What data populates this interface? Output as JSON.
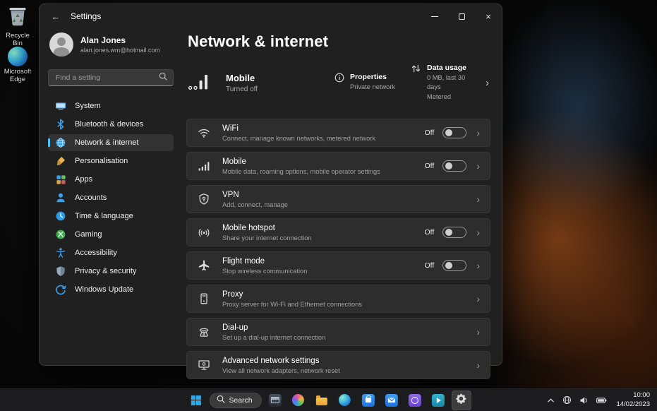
{
  "colors": {
    "accent": "#4cc2ff",
    "window_bg": "#202020",
    "card_bg": "#2d2d2d"
  },
  "desktop": {
    "icons": [
      {
        "label": "Recycle Bin",
        "icon": "recycle-bin-icon"
      },
      {
        "label": "Microsoft Edge",
        "icon": "edge-icon"
      }
    ]
  },
  "titlebar": {
    "title": "Settings"
  },
  "sidebar": {
    "profile": {
      "name": "Alan Jones",
      "email": "alan.jones.wm@hotmail.com"
    },
    "search": {
      "placeholder": "Find a setting"
    },
    "selected": "Network & internet",
    "items": [
      {
        "label": "System",
        "icon": "system-icon"
      },
      {
        "label": "Bluetooth & devices",
        "icon": "bluetooth-icon"
      },
      {
        "label": "Network & internet",
        "icon": "network-globe-icon"
      },
      {
        "label": "Personalisation",
        "icon": "personalisation-brush-icon"
      },
      {
        "label": "Apps",
        "icon": "apps-grid-icon"
      },
      {
        "label": "Accounts",
        "icon": "accounts-person-icon"
      },
      {
        "label": "Time & language",
        "icon": "clock-icon"
      },
      {
        "label": "Gaming",
        "icon": "xbox-icon"
      },
      {
        "label": "Accessibility",
        "icon": "accessibility-person-icon"
      },
      {
        "label": "Privacy & security",
        "icon": "shield-icon"
      },
      {
        "label": "Windows Update",
        "icon": "update-arrows-icon"
      }
    ]
  },
  "main": {
    "title": "Network & internet",
    "hero": {
      "title": "Mobile",
      "status": "Turned off",
      "icon": "mobile-signal-icon",
      "properties": {
        "title": "Properties",
        "value": "Private network",
        "icon": "info-icon"
      },
      "data_usage": {
        "title": "Data usage",
        "line1": "0 MB, last 30 days",
        "line2": "Metered",
        "icon": "data-usage-arrows-icon"
      }
    },
    "cards": [
      {
        "title": "WiFi",
        "subtitle": "Connect, manage known networks, metered network",
        "toggle": "Off",
        "icon": "wifi-icon"
      },
      {
        "title": "Mobile",
        "subtitle": "Mobile data, roaming options, mobile operator settings",
        "toggle": "Off",
        "icon": "mobile-bars-icon"
      },
      {
        "title": "VPN",
        "subtitle": "Add, connect, manage",
        "icon": "vpn-shield-icon"
      },
      {
        "title": "Mobile hotspot",
        "subtitle": "Share your internet connection",
        "toggle": "Off",
        "icon": "hotspot-icon"
      },
      {
        "title": "Flight mode",
        "subtitle": "Stop wireless communication",
        "toggle": "Off",
        "icon": "airplane-icon"
      },
      {
        "title": "Proxy",
        "subtitle": "Proxy server for Wi-Fi and Ethernet connections",
        "icon": "proxy-server-icon"
      },
      {
        "title": "Dial-up",
        "subtitle": "Set up a dial-up internet connection",
        "icon": "dialup-phone-icon"
      },
      {
        "title": "Advanced network settings",
        "subtitle": "View all network adapters, network reset",
        "icon": "advanced-network-icon"
      }
    ]
  },
  "taskbar": {
    "search": "Search",
    "icons": [
      "start",
      "search",
      "window-app",
      "photos-app",
      "file-explorer",
      "edge",
      "store-app",
      "mail-app",
      "purple-app",
      "teal-app",
      "settings-active"
    ],
    "tray_icons": [
      "hidden-icons-chevron",
      "network-globe",
      "volume",
      "battery"
    ],
    "clock": {
      "time": "10:00",
      "date": "14/02/2023"
    }
  }
}
